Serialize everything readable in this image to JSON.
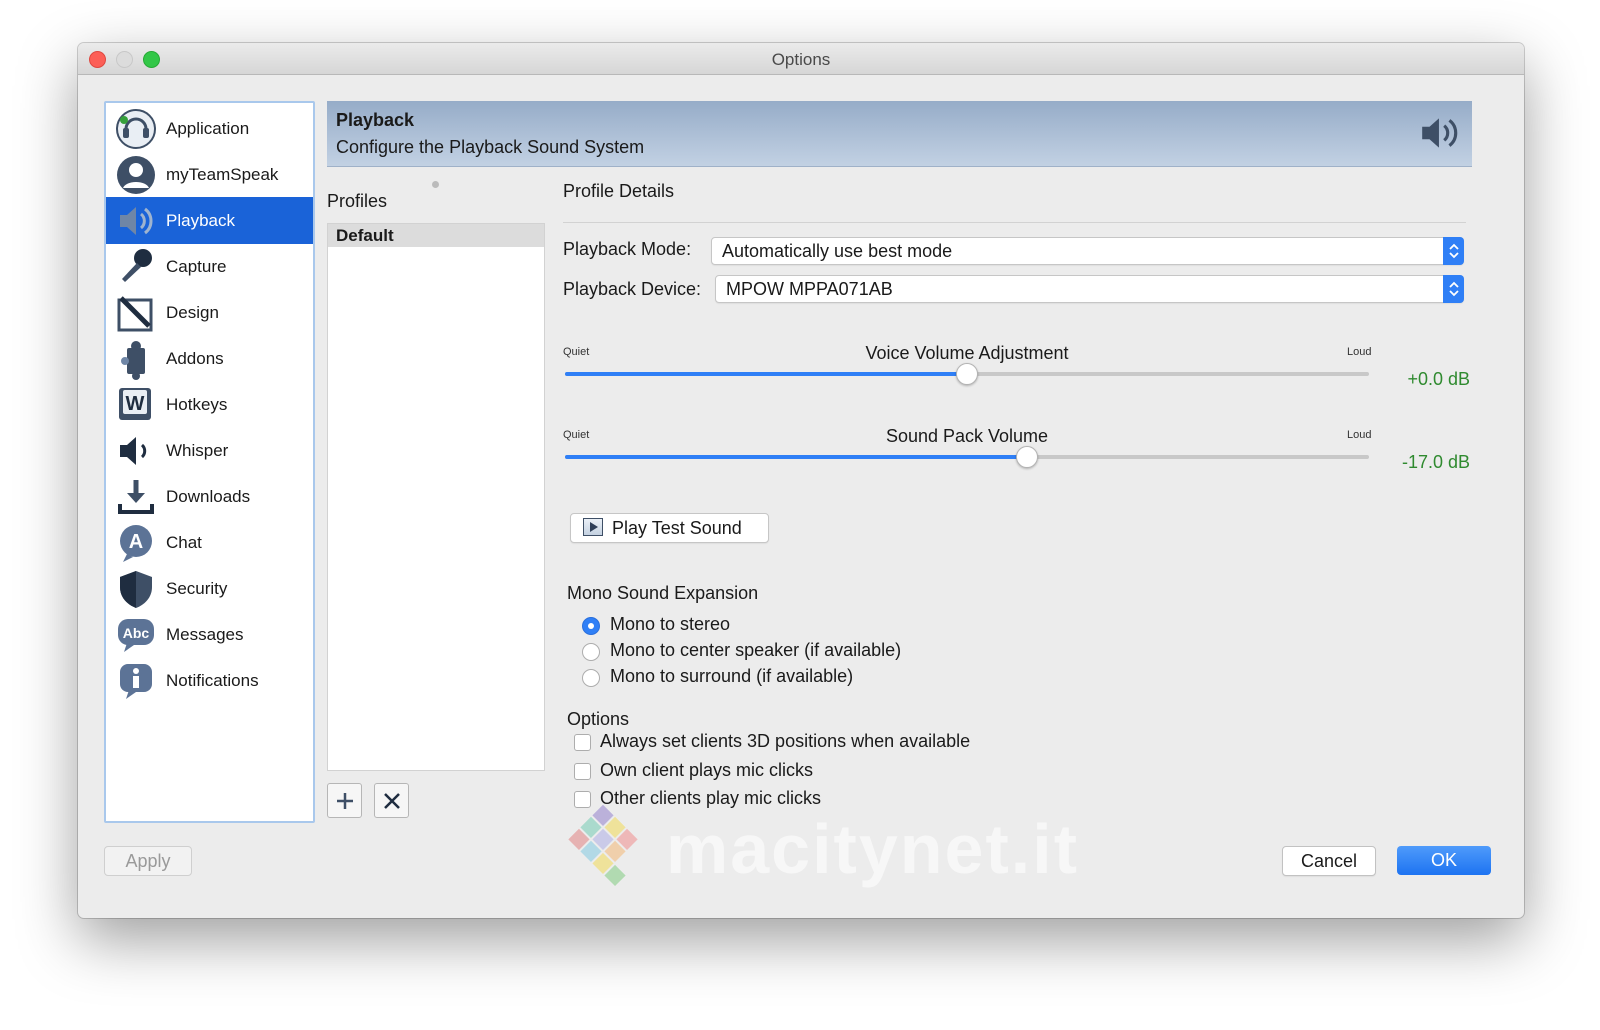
{
  "window": {
    "title": "Options"
  },
  "sidebar": {
    "items": [
      {
        "label": "Application",
        "icon": "teamspeak-logo-icon",
        "selected": false
      },
      {
        "label": "myTeamSpeak",
        "icon": "user-avatar-icon",
        "selected": false
      },
      {
        "label": "Playback",
        "icon": "speaker-icon",
        "selected": true
      },
      {
        "label": "Capture",
        "icon": "microphone-icon",
        "selected": false
      },
      {
        "label": "Design",
        "icon": "design-pen-icon",
        "selected": false
      },
      {
        "label": "Addons",
        "icon": "puzzle-icon",
        "selected": false
      },
      {
        "label": "Hotkeys",
        "icon": "keyboard-w-icon",
        "selected": false
      },
      {
        "label": "Whisper",
        "icon": "whisper-speaker-icon",
        "selected": false
      },
      {
        "label": "Downloads",
        "icon": "download-icon",
        "selected": false
      },
      {
        "label": "Chat",
        "icon": "chat-bubble-icon",
        "selected": false
      },
      {
        "label": "Security",
        "icon": "shield-icon",
        "selected": false
      },
      {
        "label": "Messages",
        "icon": "abc-bubble-icon",
        "selected": false
      },
      {
        "label": "Notifications",
        "icon": "info-bubble-icon",
        "selected": false
      }
    ]
  },
  "header": {
    "title": "Playback",
    "subtitle": "Configure the Playback Sound System",
    "icon": "speaker-icon"
  },
  "profiles": {
    "label": "Profiles",
    "items": [
      "Default"
    ],
    "add_icon": "plus-icon",
    "remove_icon": "close-icon"
  },
  "details": {
    "label": "Profile Details",
    "playback_mode": {
      "label": "Playback Mode:",
      "value": "Automatically use best mode"
    },
    "playback_device": {
      "label": "Playback Device:",
      "value": "MPOW MPPA071AB"
    },
    "voice_volume": {
      "title": "Voice Volume Adjustment",
      "min_label": "Quiet",
      "max_label": "Loud",
      "value_text": "+0.0 dB",
      "level": 0.5
    },
    "sound_pack": {
      "title": "Sound Pack Volume",
      "min_label": "Quiet",
      "max_label": "Loud",
      "value_text": "-17.0 dB",
      "level": 0.575
    },
    "play_test_sound": "Play Test Sound",
    "mono_expansion": {
      "label": "Mono Sound Expansion",
      "options": [
        {
          "label": "Mono to stereo",
          "selected": true
        },
        {
          "label": "Mono to center speaker (if available)",
          "selected": false
        },
        {
          "label": "Mono to surround (if available)",
          "selected": false
        }
      ]
    },
    "options": {
      "label": "Options",
      "checks": [
        {
          "label": "Always set clients 3D positions when available",
          "checked": false
        },
        {
          "label": "Own client plays mic clicks",
          "checked": false
        },
        {
          "label": "Other clients play mic clicks",
          "checked": false
        }
      ]
    }
  },
  "footer": {
    "apply": "Apply",
    "cancel": "Cancel",
    "ok": "OK"
  },
  "watermark": {
    "text": "macitynet.it"
  },
  "colors": {
    "accent": "#1a63d8",
    "db_value": "#2f8a2f",
    "ok_button": "#1d73f1"
  }
}
